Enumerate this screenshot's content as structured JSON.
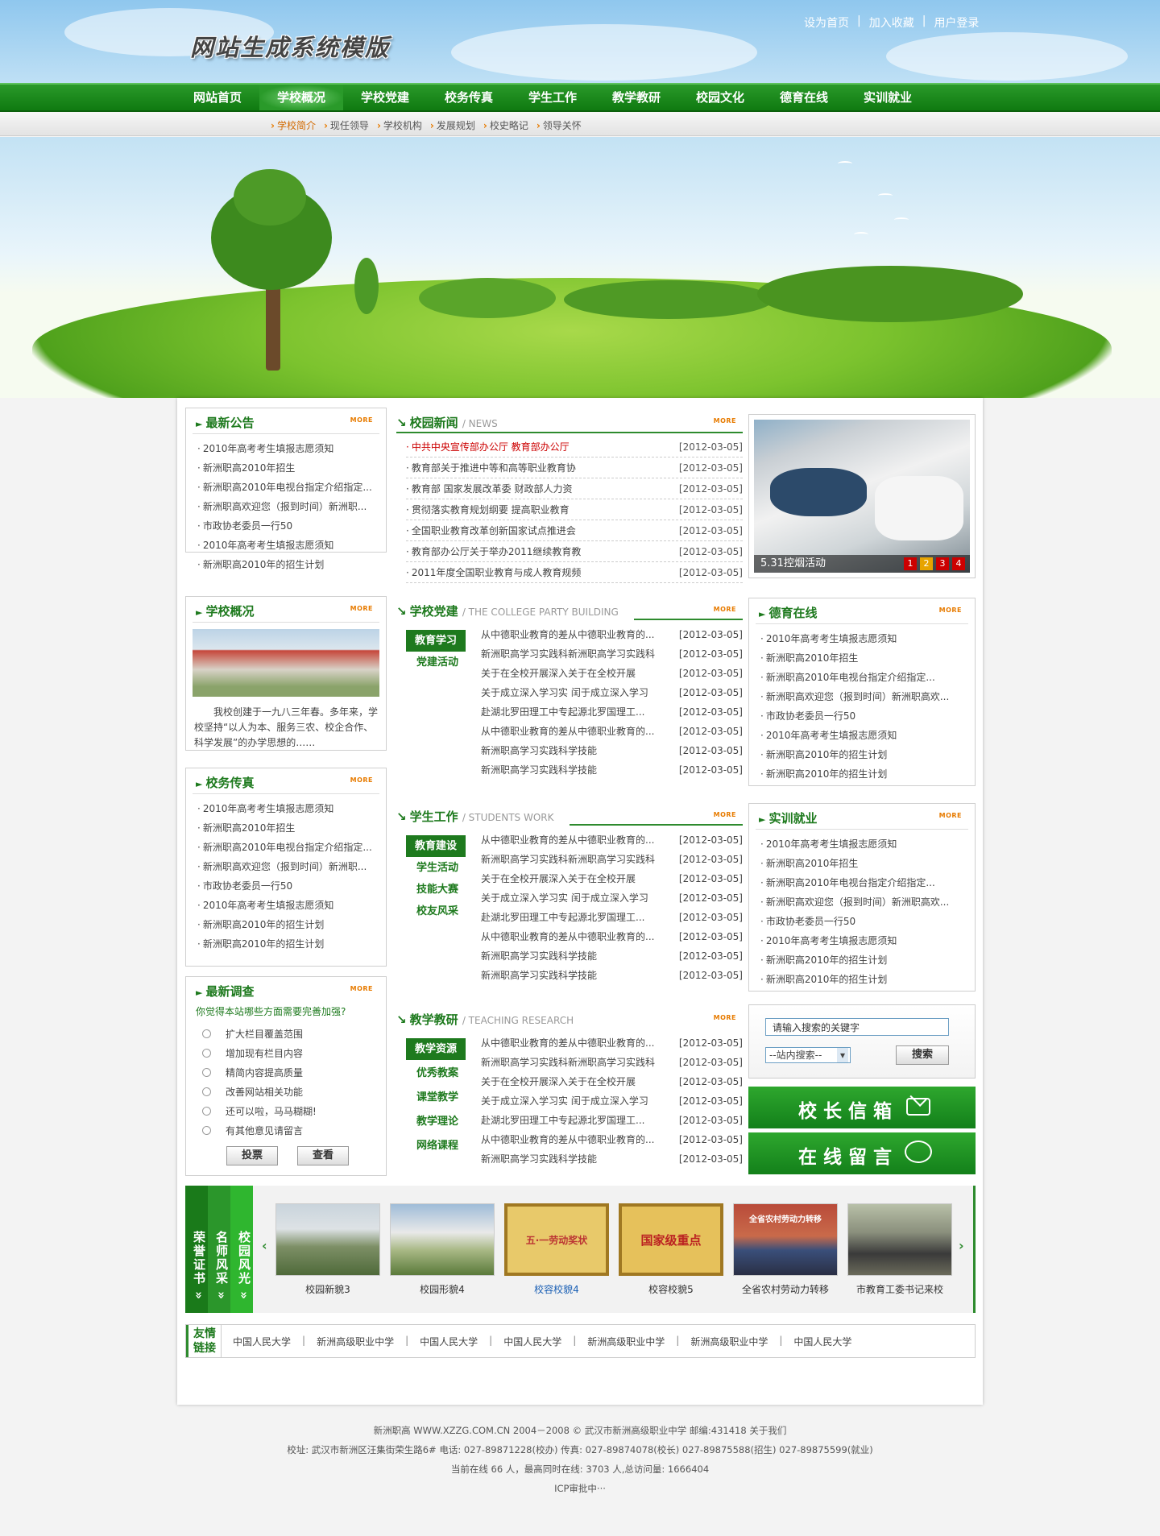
{
  "header": {
    "logo": "网站生成系统模版",
    "links": [
      "设为首页",
      "加入收藏",
      "用户登录"
    ]
  },
  "nav": [
    "网站首页",
    "学校概况",
    "学校党建",
    "校务传真",
    "学生工作",
    "教学教研",
    "校园文化",
    "德育在线",
    "实训就业"
  ],
  "subnav": [
    "学校简介",
    "现任领导",
    "学校机构",
    "发展规划",
    "校史略记",
    "领导关怀"
  ],
  "more": "MORE",
  "notice": {
    "title": "最新公告",
    "items": [
      "2010年高考考生填报志愿须知",
      "新洲职高2010年招生",
      "新洲职高2010年电视台指定介绍指定...",
      "新洲职高欢迎您（报到时间）新洲职...",
      "市政协老委员一行50",
      "2010年高考考生填报志愿须知",
      "新洲职高2010年的招生计划"
    ]
  },
  "overview": {
    "title": "学校概况",
    "text": "我校创建于一九八三年春。多年来，学校坚持“以人为本、服务三农、校企合作、科学发展”的办学思想的……"
  },
  "fax": {
    "title": "校务传真",
    "items": [
      "2010年高考考生填报志愿须知",
      "新洲职高2010年招生",
      "新洲职高2010年电视台指定介绍指定...",
      "新洲职高欢迎您（报到时间）新洲职...",
      "市政协老委员一行50",
      "2010年高考考生填报志愿须知",
      "新洲职高2010年的招生计划",
      "新洲职高2010年的招生计划"
    ]
  },
  "survey": {
    "title": "最新调查",
    "question": "你觉得本站哪些方面需要完善加强?",
    "options": [
      "扩大栏目覆盖范围",
      "增加现有栏目内容",
      "精简内容提高质量",
      "改善网站相关功能",
      "还可以啦，马马糊糊!",
      "有其他意见请留言"
    ],
    "vote": "投票",
    "view": "查看"
  },
  "news": {
    "title": "校园新闻",
    "en": "/ NEWS",
    "items": [
      {
        "t": "中共中央宣传部办公厅 教育部办公厅",
        "d": "[2012-03-05]"
      },
      {
        "t": "教育部关于推进中等和高等职业教育协",
        "d": "[2012-03-05]"
      },
      {
        "t": "教育部 国家发展改革委 财政部人力资",
        "d": "[2012-03-05]"
      },
      {
        "t": "贯彻落实教育规划纲要 提高职业教育",
        "d": "[2012-03-05]"
      },
      {
        "t": "全国职业教育改革创新国家试点推进会",
        "d": "[2012-03-05]"
      },
      {
        "t": "教育部办公厅关于举办2011继续教育教",
        "d": "[2012-03-05]"
      },
      {
        "t": "2011年度全国职业教育与成人教育规频",
        "d": "[2012-03-05]"
      }
    ]
  },
  "party": {
    "title": "学校党建",
    "en": "/ THE COLLEGE PARTY BUILDING",
    "tabs": [
      "教育学习",
      "党建活动"
    ],
    "items": [
      {
        "t": "从中德职业教育的差从中德职业教育的...",
        "d": "[2012-03-05]"
      },
      {
        "t": "新洲职高学习实践科新洲职高学习实践科",
        "d": "[2012-03-05]"
      },
      {
        "t": "关于在全校开展深入关于在全校开展",
        "d": "[2012-03-05]"
      },
      {
        "t": "关于成立深入学习实 闰于成立深入学习",
        "d": "[2012-03-05]"
      },
      {
        "t": "赴湖北罗田理工中专起源北罗国理工...",
        "d": "[2012-03-05]"
      },
      {
        "t": "从中德职业教育的差从中德职业教育的...",
        "d": "[2012-03-05]"
      },
      {
        "t": "新洲职高学习实践科学技能",
        "d": "[2012-03-05]"
      },
      {
        "t": "新洲职高学习实践科学技能",
        "d": "[2012-03-05]"
      }
    ]
  },
  "student": {
    "title": "学生工作",
    "en": "/ STUDENTS WORK",
    "tabs": [
      "教育建设",
      "学生活动",
      "技能大赛",
      "校友风采"
    ],
    "items": [
      {
        "t": "从中德职业教育的差从中德职业教育的...",
        "d": "[2012-03-05]"
      },
      {
        "t": "新洲职高学习实践科新洲职高学习实践科",
        "d": "[2012-03-05]"
      },
      {
        "t": "关于在全校开展深入关于在全校开展",
        "d": "[2012-03-05]"
      },
      {
        "t": "关于成立深入学习实 闰于成立深入学习",
        "d": "[2012-03-05]"
      },
      {
        "t": "赴湖北罗田理工中专起源北罗国理工...",
        "d": "[2012-03-05]"
      },
      {
        "t": "从中德职业教育的差从中德职业教育的...",
        "d": "[2012-03-05]"
      },
      {
        "t": "新洲职高学习实践科学技能",
        "d": "[2012-03-05]"
      },
      {
        "t": "新洲职高学习实践科学技能",
        "d": "[2012-03-05]"
      }
    ]
  },
  "teaching": {
    "title": "教学教研",
    "en": "/ TEACHING RESEARCH",
    "tabs": [
      "教学资源",
      "优秀教案",
      "课堂教学",
      "教学理论",
      "网络课程"
    ],
    "items": [
      {
        "t": "从中德职业教育的差从中德职业教育的...",
        "d": "[2012-03-05]"
      },
      {
        "t": "新洲职高学习实践科新洲职高学习实践科",
        "d": "[2012-03-05]"
      },
      {
        "t": "关于在全校开展深入关于在全校开展",
        "d": "[2012-03-05]"
      },
      {
        "t": "关于成立深入学习实 闰于成立深入学习",
        "d": "[2012-03-05]"
      },
      {
        "t": "赴湖北罗田理工中专起源北罗国理工...",
        "d": "[2012-03-05]"
      },
      {
        "t": "从中德职业教育的差从中德职业教育的...",
        "d": "[2012-03-05]"
      },
      {
        "t": "新洲职高学习实践科学技能",
        "d": "[2012-03-05]"
      }
    ]
  },
  "photo": {
    "caption": "5.31控烟活动",
    "pages": [
      "1",
      "2",
      "3",
      "4"
    ]
  },
  "moral": {
    "title": "德育在线",
    "items": [
      "2010年高考考生填报志愿须知",
      "新洲职高2010年招生",
      "新洲职高2010年电视台指定介绍指定...",
      "新洲职高欢迎您（报到时间）新洲职高欢...",
      "市政协老委员一行50",
      "2010年高考考生填报志愿须知",
      "新洲职高2010年的招生计划",
      "新洲职高2010年的招生计划"
    ]
  },
  "training": {
    "title": "实训就业",
    "items": [
      "2010年高考考生填报志愿须知",
      "新洲职高2010年招生",
      "新洲职高2010年电视台指定介绍指定...",
      "新洲职高欢迎您（报到时间）新洲职高欢...",
      "市政协老委员一行50",
      "2010年高考考生填报志愿须知",
      "新洲职高2010年的招生计划",
      "新洲职高2010年的招生计划"
    ]
  },
  "search": {
    "placeholder": "请输入搜索的关键字",
    "scope": "--站内搜索--",
    "button": "搜索"
  },
  "mailbox": "校长信箱",
  "message": "在线留言",
  "showcase": {
    "tabs": [
      "荣誉证书",
      "名师风采",
      "校园风光"
    ],
    "items": [
      {
        "label": "校园新貌3",
        "color": "#7c8f6c"
      },
      {
        "label": "校园形貌4",
        "color": "#9aaa7a"
      },
      {
        "label": "校容校貌4",
        "color": "#e8c96a",
        "active": true,
        "text": "五·一劳动奖状"
      },
      {
        "label": "校容校貌5",
        "color": "#e6c15b",
        "text": "国家级重点"
      },
      {
        "label": "全省农村劳动力转移",
        "color": "#b94b3a",
        "text": "全省农村劳动力转移"
      },
      {
        "label": "市教育工委书记来校",
        "color": "#8a8f7c"
      }
    ]
  },
  "links": {
    "title": "友情链接",
    "items": [
      "中国人民大学",
      "新洲高级职业中学",
      "中国人民大学",
      "中国人民大学",
      "新洲高级职业中学",
      "新洲高级职业中学",
      "中国人民大学"
    ]
  },
  "footer": {
    "line1": "新洲职高 WWW.XZZG.COM.CN   2004－2008 ©   武汉市新洲高级职业中学   邮编:431418   关于我们",
    "line2": "校址: 武汉市新洲区汪集街荣生路6# 电话: 027-89871228(校办) 传真: 027-89874078(校长) 027-89875588(招生) 027-89875599(就业)",
    "line3": "当前在线 66 人，最高同时在线: 3703 人,总访问量: 1666404",
    "line4": "ICP审批中···"
  }
}
